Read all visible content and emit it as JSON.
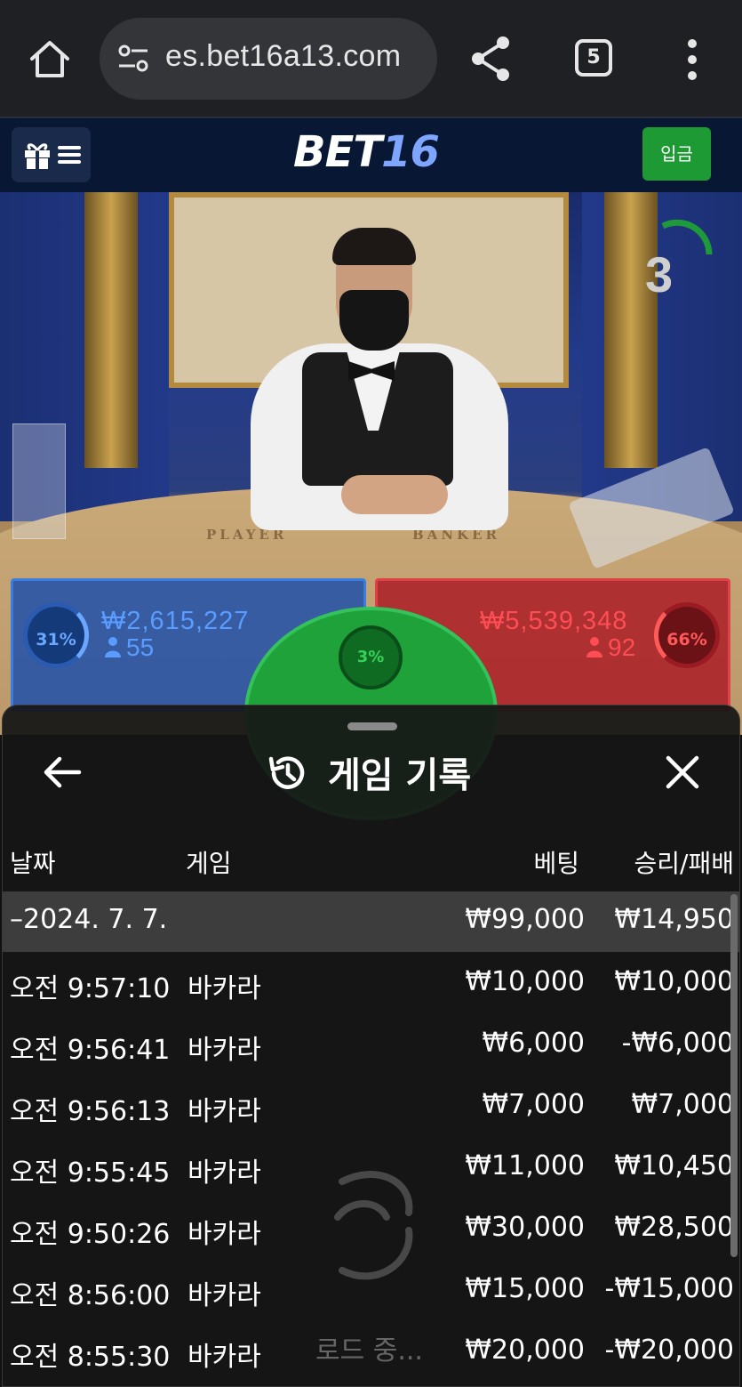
{
  "browser": {
    "url": "es.bet16a13.com",
    "tab_count": "5"
  },
  "header": {
    "logo_part1": "BET",
    "logo_part2": "16",
    "deposit_label": "입금"
  },
  "live": {
    "timer": "3",
    "table_labels": [
      "PLAYER",
      "BANKER"
    ],
    "player": {
      "percent": "31%",
      "amount": "₩2,615,227",
      "count": "55"
    },
    "tie": {
      "percent": "3%"
    },
    "banker": {
      "percent": "66%",
      "amount": "₩5,539,348",
      "count": "92"
    }
  },
  "sheet": {
    "title": "게임 기록",
    "columns": {
      "date": "날짜",
      "game": "게임",
      "bet": "베팅",
      "result": "승리/패배"
    },
    "date_group": {
      "date": "–2024. 7. 7.",
      "bet": "₩99,000",
      "result": "₩14,950"
    },
    "rows": [
      {
        "time": "오전 9:57:10",
        "game": "바카라",
        "bet": "₩10,000",
        "result": "₩10,000"
      },
      {
        "time": "오전 9:56:41",
        "game": "바카라",
        "bet": "₩6,000",
        "result": "-₩6,000"
      },
      {
        "time": "오전 9:56:13",
        "game": "바카라",
        "bet": "₩7,000",
        "result": "₩7,000"
      },
      {
        "time": "오전 9:55:45",
        "game": "바카라",
        "bet": "₩11,000",
        "result": "₩10,450"
      },
      {
        "time": "오전 9:50:26",
        "game": "바카라",
        "bet": "₩30,000",
        "result": "₩28,500"
      },
      {
        "time": "오전 8:56:00",
        "game": "바카라",
        "bet": "₩15,000",
        "result": "-₩15,000"
      },
      {
        "time": "오전 8:55:30",
        "game": "바카라",
        "bet": "₩20,000",
        "result": "-₩20,000"
      }
    ],
    "loading_text": "로드 중..."
  },
  "colors": {
    "player": "#3a7de0",
    "banker": "#e04048",
    "tie": "#1fa23a",
    "deposit": "#1d9a33"
  }
}
